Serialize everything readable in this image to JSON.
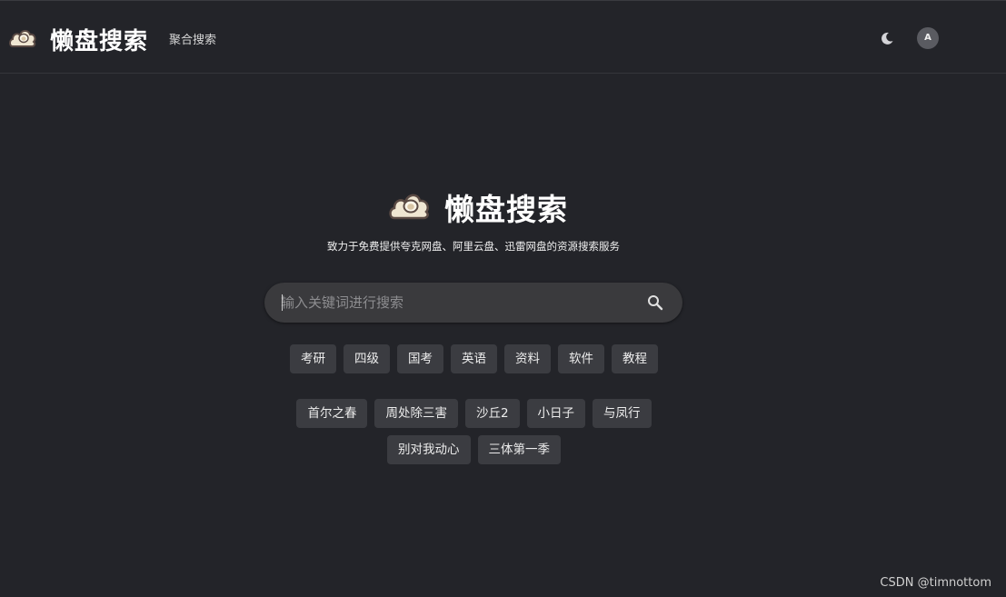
{
  "header": {
    "brand": "懒盘搜索",
    "nav": "聚合搜索",
    "avatar_letter": "A"
  },
  "hero": {
    "title": "懒盘搜索",
    "subtitle": "致力于免费提供夸克网盘、阿里云盘、迅雷网盘的资源搜索服务"
  },
  "search": {
    "placeholder": "输入关键词进行搜索"
  },
  "categories": [
    "考研",
    "四级",
    "国考",
    "英语",
    "资料",
    "软件",
    "教程"
  ],
  "hot_row1": [
    "首尔之春",
    "周处除三害",
    "沙丘2",
    "小日子",
    "与凤行"
  ],
  "hot_row2": [
    "别对我动心",
    "三体第一季"
  ],
  "watermark": "CSDN @timnottom",
  "icons": {
    "logo": "cloud-egg-icon",
    "theme": "moon-icon",
    "search": "search-icon"
  },
  "colors": {
    "background": "#232429",
    "tag_bg": "#3b3c41",
    "search_bg": "#3a3a3d"
  }
}
